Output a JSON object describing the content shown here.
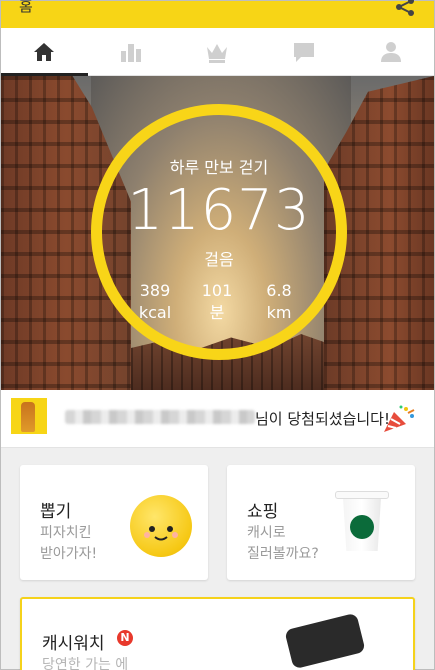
{
  "app": {
    "title": "홈"
  },
  "tabs": [
    {
      "name": "home",
      "icon": "home-icon",
      "active": true
    },
    {
      "name": "stats",
      "icon": "bar-chart-icon",
      "active": false
    },
    {
      "name": "ranking",
      "icon": "crown-icon",
      "active": false
    },
    {
      "name": "chat",
      "icon": "chat-bubble-icon",
      "active": false
    },
    {
      "name": "profile",
      "icon": "person-icon",
      "active": false
    }
  ],
  "hero": {
    "title": "하루 만보 걷기",
    "steps": "11673",
    "steps_unit": "걸음",
    "stats": [
      {
        "value": "389",
        "unit": "kcal"
      },
      {
        "value": "101",
        "unit": "분"
      },
      {
        "value": "6.8",
        "unit": "km"
      }
    ]
  },
  "banner": {
    "message": "님이 당첨되셨습니다!"
  },
  "cards": {
    "draw": {
      "title": "뽑기",
      "subtitle_line1": "피자치킨",
      "subtitle_line2": "받아가자!"
    },
    "shopping": {
      "title": "쇼핑",
      "subtitle_line1": "캐시로",
      "subtitle_line2": "질러볼까요?"
    },
    "cashwatch": {
      "title": "캐시워치",
      "badge": "N",
      "subtitle": "당연한 가는 에"
    }
  },
  "colors": {
    "accent_yellow": "#f8d518",
    "badge_red": "#e8392c"
  }
}
